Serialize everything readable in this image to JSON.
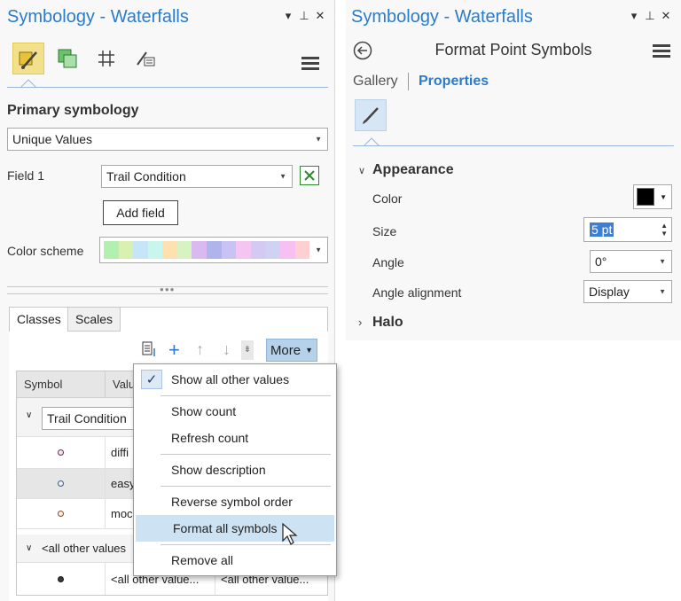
{
  "left": {
    "title": "Symbology - Waterfalls",
    "controls": [
      "▾",
      "⊥",
      "✕"
    ],
    "primary_symbology_heading": "Primary symbology",
    "renderer": "Unique Values",
    "field1_label": "Field 1",
    "field1_value": "Trail Condition",
    "add_field_label": "Add field",
    "color_scheme_label": "Color scheme",
    "color_scheme": [
      "#b3f0b0",
      "#d8f0b0",
      "#c6e6f7",
      "#c8f5ec",
      "#ffe0b0",
      "#d8f3c2",
      "#d9b9f0",
      "#b0b4ec",
      "#c9c2f4",
      "#f4c5f0",
      "#d4c9f2",
      "#cfd2f3",
      "#f8c0f2",
      "#ffd0d0"
    ],
    "tabs": [
      "Classes",
      "Scales"
    ],
    "more_label": "More",
    "table": {
      "col_symbol": "Symbol",
      "col_value": "Valu",
      "group_label": "Trail Condition",
      "rows": [
        {
          "value": "diffi"
        },
        {
          "value": "easy"
        },
        {
          "value": "moc"
        }
      ],
      "other_group_label": "<all other values",
      "other_row_value": "<all other value...",
      "other_row_label": "<all other value..."
    }
  },
  "menu": {
    "items": {
      "show_all_other": "Show all other values",
      "show_count": "Show count",
      "refresh_count": "Refresh count",
      "show_description": "Show description",
      "reverse_order": "Reverse symbol order",
      "format_all": "Format all symbols",
      "remove_all": "Remove all"
    },
    "check_mark": "✓"
  },
  "right": {
    "title": "Symbology - Waterfalls",
    "controls": [
      "▾",
      "⊥",
      "✕"
    ],
    "page_title": "Format Point Symbols",
    "tab_gallery": "Gallery",
    "tab_properties": "Properties",
    "appearance_heading": "Appearance",
    "color_label": "Color",
    "color_value": "#000000",
    "size_label": "Size",
    "size_value": "5 pt",
    "angle_label": "Angle",
    "angle_value": "0°",
    "angle_alignment_label": "Angle alignment",
    "angle_alignment_value": "Display",
    "halo_heading": "Halo"
  },
  "colors": {
    "accent": "#2b7bcc",
    "active_tool": "#f3e08c",
    "menu_hover": "#cde3f4",
    "more_button": "#b6d2ea"
  }
}
